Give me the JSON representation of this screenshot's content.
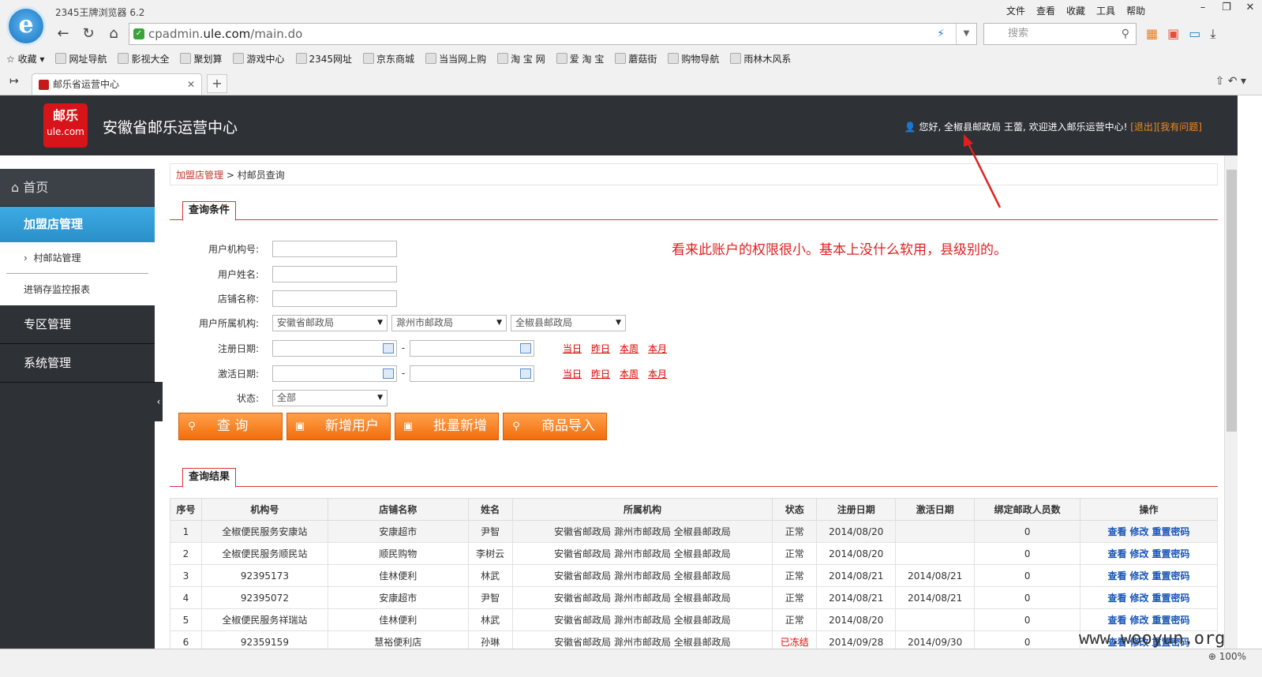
{
  "browser": {
    "title": "2345王牌浏览器 6.2",
    "menu": [
      "文件",
      "查看",
      "收藏",
      "工具",
      "帮助"
    ],
    "address_prefix": "cpadmin.",
    "address_domain": "ule.com",
    "address_suffix": "/main.do",
    "search_placeholder": "搜索",
    "bookmarks": [
      "收藏",
      "网址导航",
      "影视大全",
      "聚划算",
      "游戏中心",
      "2345网址",
      "京东商城",
      "当当网上购",
      "淘 宝 网",
      "爱 淘 宝",
      "蘑菇街",
      "购物导航",
      "雨林木风系"
    ],
    "tab_title": "邮乐省运营中心",
    "zoom": "100%"
  },
  "header": {
    "logo_line1": "邮乐",
    "logo_line2": "ule.com",
    "title": "安徽省邮乐运营中心",
    "welcome": "您好, 全椒县邮政局 王蕾, 欢迎进入邮乐运营中心!",
    "logout": "[退出]",
    "help": "[我有问题]"
  },
  "sidebar": {
    "home": "首页",
    "active_group": "加盟店管理",
    "sub_items": [
      "村邮站管理",
      "进销存监控报表"
    ],
    "groups": [
      "专区管理",
      "系统管理"
    ]
  },
  "breadcrumb": {
    "level1": "加盟店管理",
    "sep": ">",
    "level2": "村邮员查询"
  },
  "query": {
    "section_title": "查询条件",
    "org_no_label": "用户机构号:",
    "user_name_label": "用户姓名:",
    "shop_name_label": "店铺名称:",
    "org_label": "用户所属机构:",
    "org_province": "安徽省邮政局",
    "org_city": "滁州市邮政局",
    "org_county": "全椒县邮政局",
    "reg_date_label": "注册日期:",
    "act_date_label": "激活日期:",
    "status_label": "状态:",
    "status_value": "全部",
    "dash": "-",
    "quick": [
      "当日",
      "昨日",
      "本周",
      "本月"
    ]
  },
  "buttons": {
    "query": "查 询",
    "add_user": "新增用户",
    "batch_add": "批量新增",
    "import_goods": "商品导入"
  },
  "annotation": "看来此账户的权限很小。基本上没什么软用，县级别的。",
  "results": {
    "section_title": "查询结果",
    "headers": [
      "序号",
      "机构号",
      "店铺名称",
      "姓名",
      "所属机构",
      "状态",
      "注册日期",
      "激活日期",
      "绑定邮政人员数",
      "操作"
    ],
    "ops": [
      "查看",
      "修改",
      "重置密码"
    ],
    "rows": [
      [
        "1",
        "全椒便民服务安康站",
        "安康超市",
        "尹智",
        "安徽省邮政局 滁州市邮政局 全椒县邮政局",
        "正常",
        "2014/08/20",
        "",
        "0"
      ],
      [
        "2",
        "全椒便民服务顺民站",
        "顺民购物",
        "李树云",
        "安徽省邮政局 滁州市邮政局 全椒县邮政局",
        "正常",
        "2014/08/20",
        "",
        "0"
      ],
      [
        "3",
        "92395173",
        "佳林便利",
        "林武",
        "安徽省邮政局 滁州市邮政局 全椒县邮政局",
        "正常",
        "2014/08/21",
        "2014/08/21",
        "0"
      ],
      [
        "4",
        "92395072",
        "安康超市",
        "尹智",
        "安徽省邮政局 滁州市邮政局 全椒县邮政局",
        "正常",
        "2014/08/21",
        "2014/08/21",
        "0"
      ],
      [
        "5",
        "全椒便民服务祥瑞站",
        "佳林便利",
        "林武",
        "安徽省邮政局 滁州市邮政局 全椒县邮政局",
        "正常",
        "2014/08/20",
        "",
        "0"
      ],
      [
        "6",
        "92359159",
        "慧裕便利店",
        "孙琳",
        "安徽省邮政局 滁州市邮政局 全椒县邮政局",
        "已冻结",
        "2014/09/28",
        "2014/09/30",
        "0"
      ]
    ]
  },
  "watermark": "www.wooyun.org",
  "colors": {
    "accent_red": "#d7141a",
    "orange": "#f26d0c",
    "sidebar_active": "#2a8fc8",
    "header_bg": "#2e3136"
  }
}
